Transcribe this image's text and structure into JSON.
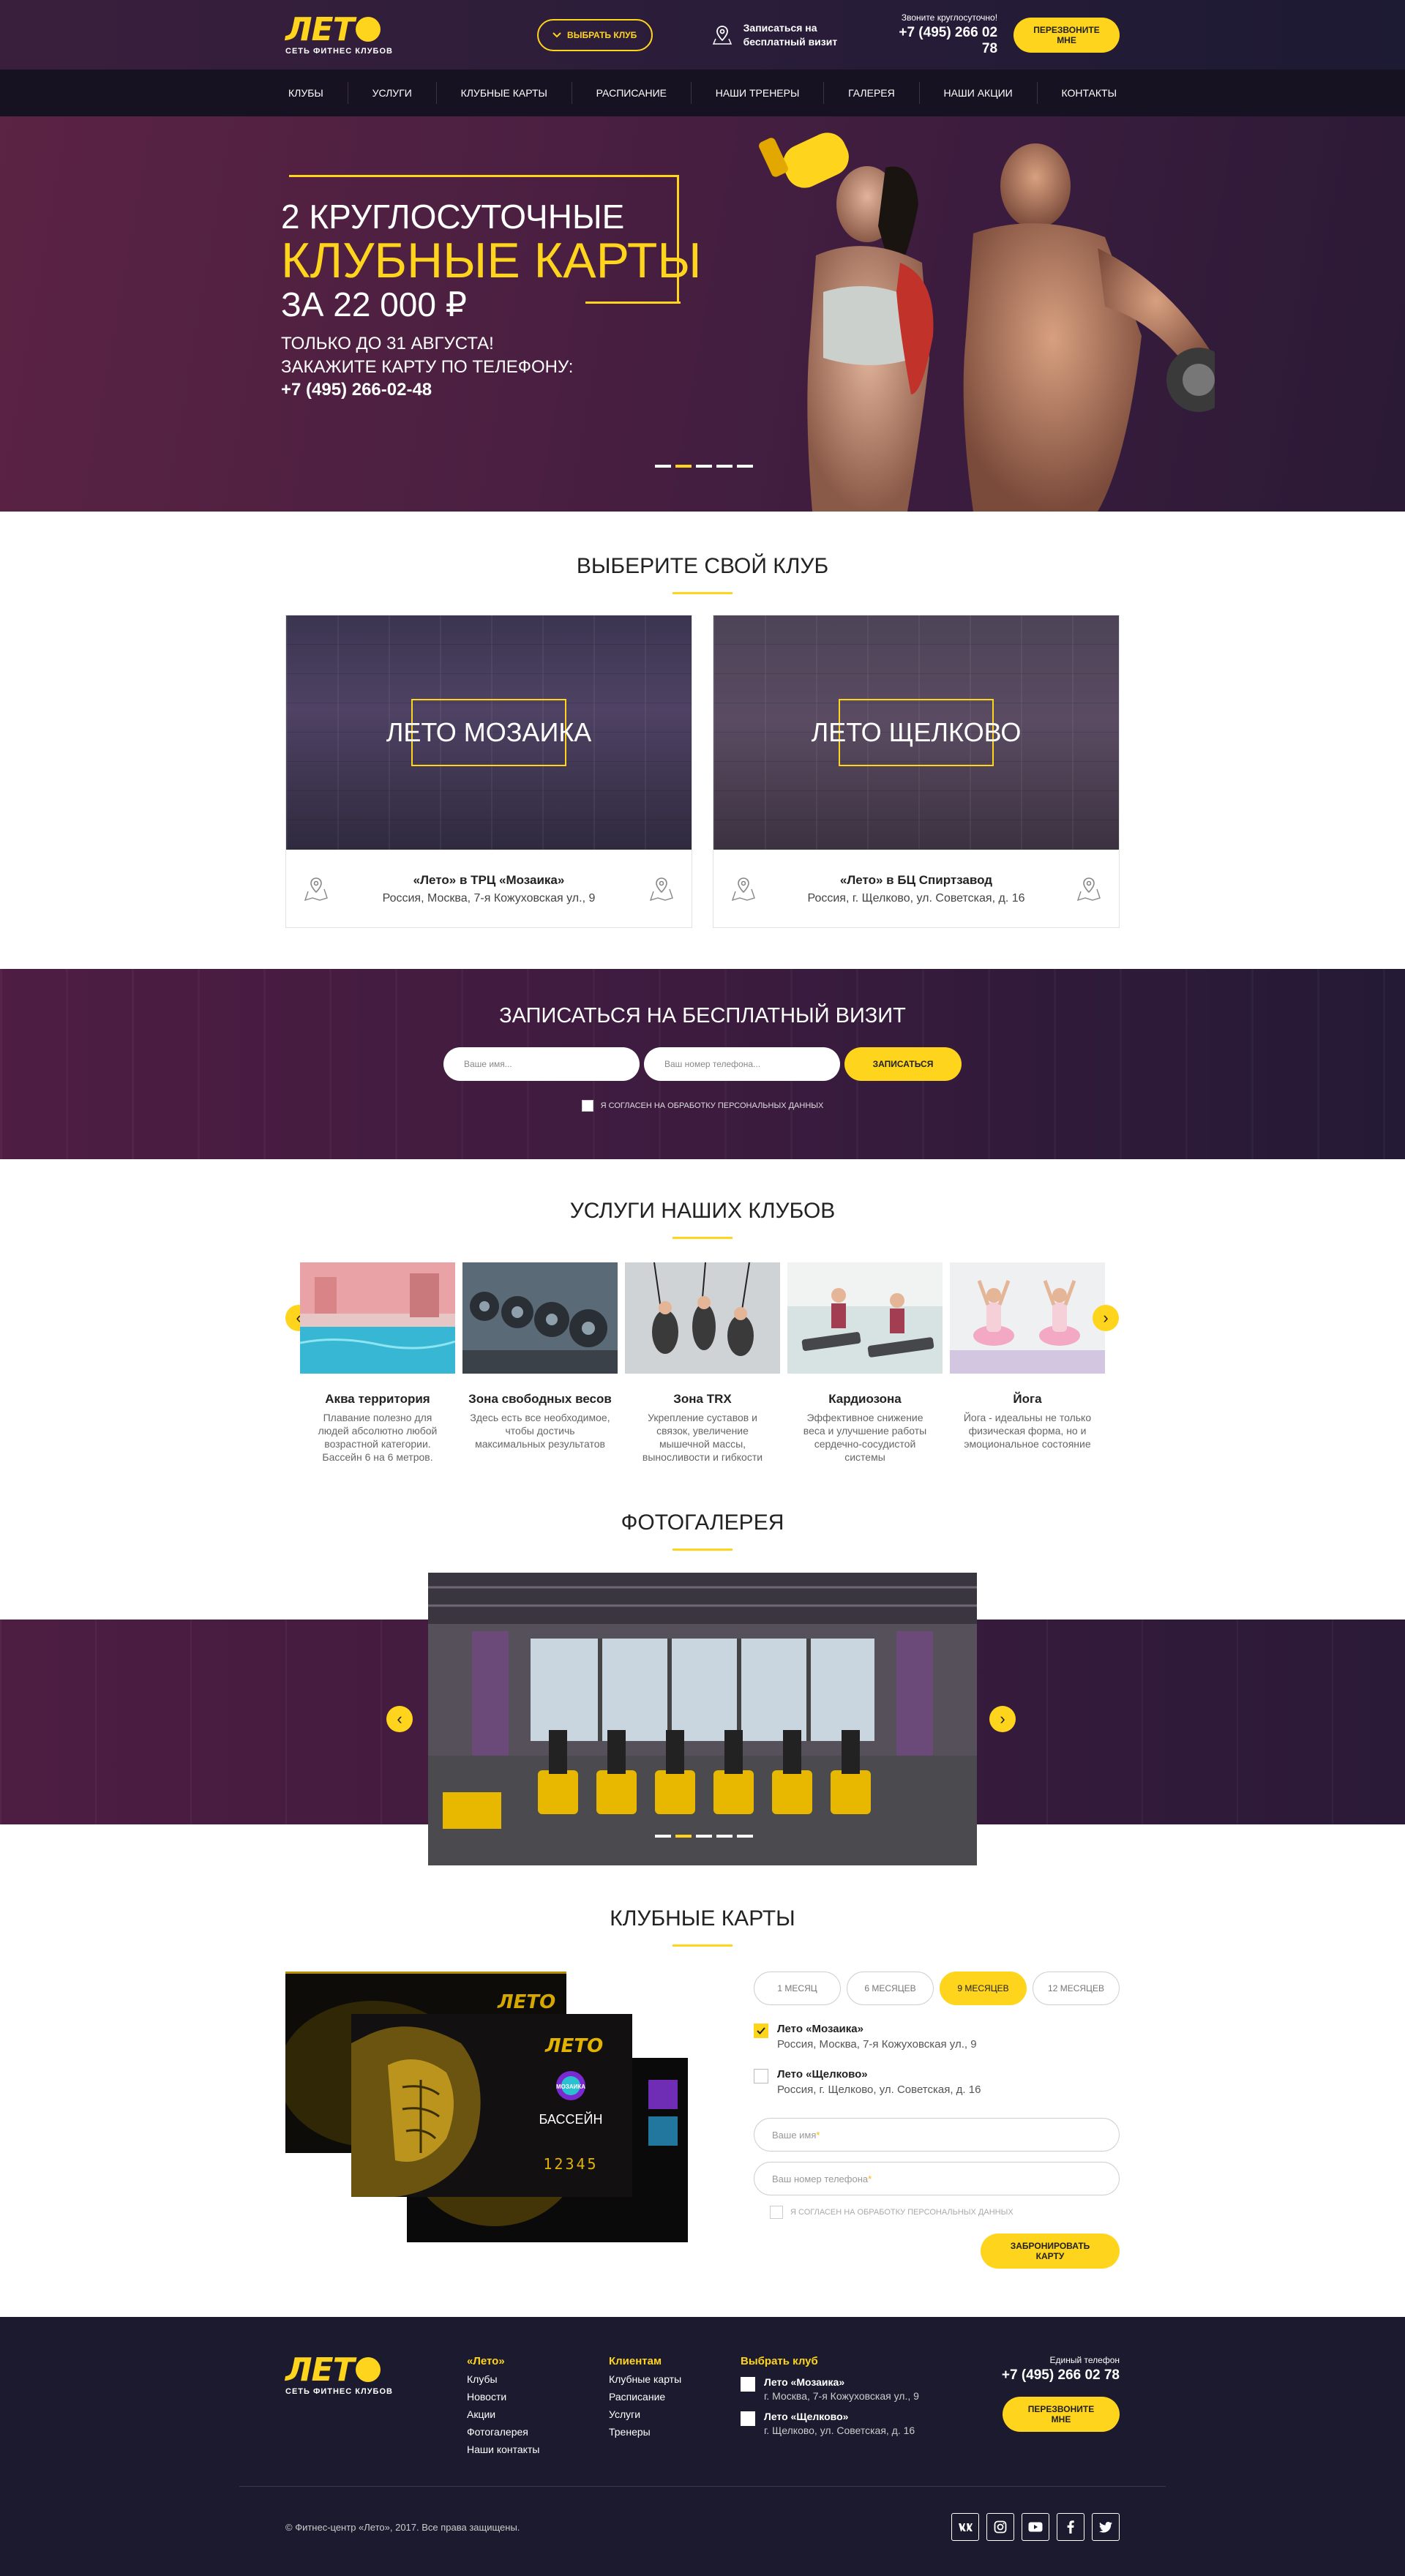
{
  "header": {
    "logo_word": "ЛЕТ",
    "logo_tagline": "СЕТЬ ФИТНЕС КЛУБОВ",
    "choose_club": "ВЫБРАТЬ КЛУБ",
    "free_visit": "Записаться на бесплатный визит",
    "phone_caption": "Звоните круглосуточно!",
    "phone": "+7 (495) 266 02 78",
    "callback": "ПЕРЕЗВОНИТЕ МНЕ"
  },
  "nav": {
    "items": [
      "КЛУБЫ",
      "УСЛУГИ",
      "КЛУБНЫЕ КАРТЫ",
      "РАСПИСАНИЕ",
      "НАШИ ТРЕНЕРЫ",
      "ГАЛЕРЕЯ",
      "НАШИ АКЦИИ",
      "КОНТАКТЫ"
    ]
  },
  "hero": {
    "line1": "2 КРУГЛОСУТОЧНЫЕ",
    "line2": "КЛУБНЫЕ КАРТЫ",
    "line3": "ЗА 22 000 ₽",
    "sub1": "ТОЛЬКО ДО 31 АВГУСТА!",
    "sub2": "ЗАКАЖИТЕ КАРТУ ПО ТЕЛЕФОНУ:",
    "phone": "+7 (495) 266-02-48",
    "slides": 5,
    "active_slide": 2
  },
  "clubs": {
    "title": "ВЫБЕРИТЕ СВОЙ КЛУБ",
    "items": [
      {
        "photo_title": "ЛЕТО МОЗАИКА",
        "name": "«Лето» в ТРЦ «Мозаика»",
        "address": "Россия, Москва, 7-я Кожуховская ул., 9"
      },
      {
        "photo_title": "ЛЕТО ЩЕЛКОВО",
        "name": "«Лето» в БЦ Спиртзавод",
        "address": "Россия, г. Щелково, ул. Советская, д. 16"
      }
    ]
  },
  "free_visit": {
    "title": "ЗАПИСАТЬСЯ НА БЕСПЛАТНЫЙ ВИЗИТ",
    "name_placeholder": "Ваше имя...",
    "phone_placeholder": "Ваш номер телефона...",
    "submit": "ЗАПИСАТЬСЯ",
    "consent": "Я СОГЛАСЕН НА ОБРАБОТКУ ПЕРСОНАЛЬНЫХ ДАННЫХ"
  },
  "services": {
    "title": "УСЛУГИ НАШИХ КЛУБОВ",
    "items": [
      {
        "name": "Аква территория",
        "desc": "Плавание полезно для людей абсолютно любой возрастной категории. Бассейн 6 на 6 метров."
      },
      {
        "name": "Зона свободных весов",
        "desc": "Здесь есть все необходимое, чтобы достичь максимальных результатов"
      },
      {
        "name": "Зона TRX",
        "desc": "Укрепление суставов и связок, увеличение мышечной массы, выносливости и гибкости"
      },
      {
        "name": "Кардиозона",
        "desc": "Эффективное снижение веса и улучшение работы сердечно-сосудистой системы"
      },
      {
        "name": "Йога",
        "desc": "Йога - идеальны не только физическая форма, но и эмоциональное состояние"
      }
    ],
    "prev": "‹",
    "next": "›"
  },
  "gallery": {
    "title": "ФОТОГАЛЕРЕЯ",
    "slides": 5,
    "active_slide": 2,
    "prev": "‹",
    "next": "›"
  },
  "cards": {
    "title": "КЛУБНЫЕ КАРТЫ",
    "card_logo": "ЛЕТО",
    "card_brand": "МОЗАИКА",
    "card_label": "БАССЕЙН",
    "card_number": "12345",
    "periods": [
      "1 МЕСЯЦ",
      "6 МЕСЯЦЕВ",
      "9 МЕСЯЦЕВ",
      "12 МЕСЯЦЕВ"
    ],
    "active_period": 2,
    "clubs": [
      {
        "name": "Лето «Мозаика»",
        "address": "Россия, Москва, 7-я Кожуховская ул., 9",
        "checked": true
      },
      {
        "name": "Лето «Щелково»",
        "address": "Россия, г. Щелково, ул. Советская, д. 16",
        "checked": false
      }
    ],
    "name_placeholder": "Ваше имя",
    "phone_placeholder": "Ваш номер телефона",
    "required_mark": "*",
    "consent": "Я СОГЛАСЕН НА ОБРАБОТКУ ПЕРСОНАЛЬНЫХ ДАННЫХ",
    "submit": "ЗАБРОНИРОВАТЬ КАРТУ"
  },
  "footer": {
    "col1_title": "«Лето»",
    "col1_links": [
      "Клубы",
      "Новости",
      "Акции",
      "Фотогалерея",
      "Наши контакты"
    ],
    "col2_title": "Клиентам",
    "col2_links": [
      "Клубные карты",
      "Расписание",
      "Услуги",
      "Тренеры"
    ],
    "col3_title": "Выбрать клуб",
    "clubs": [
      {
        "name": "Лето «Мозаика»",
        "address": "г. Москва, 7-я Кожуховская ул., 9"
      },
      {
        "name": "Лето «Щелково»",
        "address": "г. Щелково, ул. Советская, д. 16"
      }
    ],
    "phone_caption": "Единый телефон",
    "phone": "+7 (495) 266 02 78",
    "callback": "ПЕРЕЗВОНИТЕ МНЕ",
    "copyright": "© Фитнес-центр «Лето», 2017. Все права защищены.",
    "socials": [
      "vk-icon",
      "instagram-icon",
      "youtube-icon",
      "facebook-icon",
      "twitter-icon"
    ]
  },
  "colors": {
    "accent": "#ffd41c",
    "dark_header": "#2a1d3a",
    "nav": "#171221",
    "footer": "#1b1a2e",
    "plum": "#4f1d43"
  }
}
